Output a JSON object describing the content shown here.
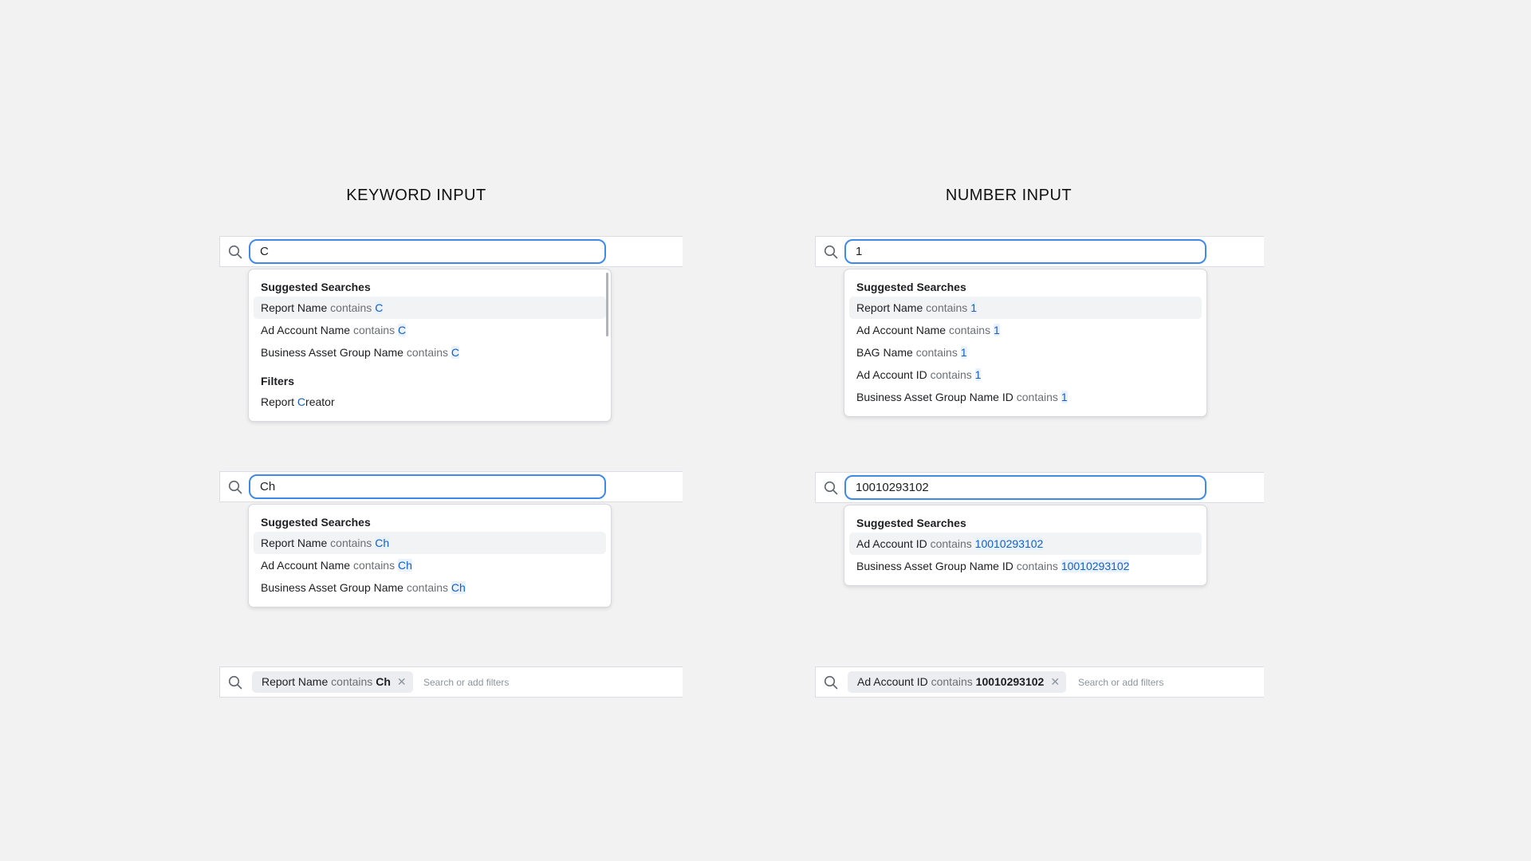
{
  "keyword": {
    "title": "KEYWORD INPUT",
    "example1": {
      "query": "C",
      "suggested_heading": "Suggested Searches",
      "suggestions": [
        {
          "field": "Report Name",
          "op": "contains",
          "term": "C"
        },
        {
          "field": "Ad Account Name",
          "op": "contains",
          "term": "C"
        },
        {
          "field": "Business Asset Group Name",
          "op": "contains",
          "term": "C"
        }
      ],
      "filters_heading": "Filters",
      "filter": {
        "pre": "Report ",
        "match": "C",
        "post": "reator"
      }
    },
    "example2": {
      "query": "Ch",
      "suggested_heading": "Suggested Searches",
      "suggestions": [
        {
          "field": "Report Name",
          "op": "contains",
          "term": "Ch"
        },
        {
          "field": "Ad Account Name",
          "op": "contains",
          "term": "Ch"
        },
        {
          "field": "Business Asset Group Name",
          "op": "contains",
          "term": "Ch"
        }
      ]
    },
    "example3": {
      "chip": {
        "field": "Report Name",
        "op": "contains",
        "term": "Ch"
      },
      "placeholder": "Search or add filters"
    }
  },
  "number": {
    "title": "NUMBER INPUT",
    "example1": {
      "query": "1",
      "suggested_heading": "Suggested Searches",
      "suggestions": [
        {
          "field": "Report Name",
          "op": "contains",
          "term": "1"
        },
        {
          "field": "Ad Account Name",
          "op": "contains",
          "term": "1"
        },
        {
          "field": "BAG Name",
          "op": "contains",
          "term": "1"
        },
        {
          "field": "Ad Account ID",
          "op": "contains",
          "term": "1"
        },
        {
          "field": "Business Asset Group Name ID",
          "op": "contains",
          "term": "1"
        }
      ]
    },
    "example2": {
      "query": "10010293102",
      "suggested_heading": "Suggested Searches",
      "suggestions": [
        {
          "field": "Ad Account ID",
          "op": "contains",
          "term": "10010293102"
        },
        {
          "field": "Business Asset Group Name ID",
          "op": "contains",
          "term": "10010293102"
        }
      ]
    },
    "example3": {
      "chip": {
        "field": "Ad Account ID",
        "op": "contains",
        "term": "10010293102"
      },
      "placeholder": "Search or add filters"
    }
  },
  "icons": {
    "search": "search-icon",
    "close": "close-icon"
  },
  "colors": {
    "focus_border": "#3f8ae8",
    "highlight_text": "#1160c4",
    "background": "#f2f2f2"
  }
}
